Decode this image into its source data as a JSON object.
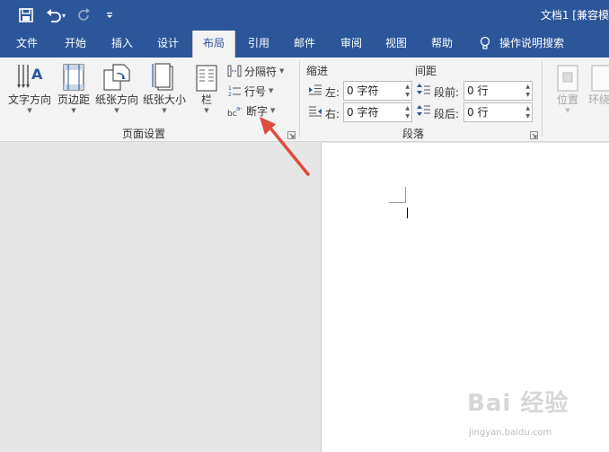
{
  "titlebar": {
    "doc_title": "文档1 [兼容模"
  },
  "tabs": [
    "文件",
    "开始",
    "插入",
    "设计",
    "布局",
    "引用",
    "邮件",
    "审阅",
    "视图",
    "帮助"
  ],
  "tell_me": "操作说明搜索",
  "ribbon": {
    "text_direction": "文字方向",
    "margins": "页边距",
    "orientation": "纸张方向",
    "size": "纸张大小",
    "columns": "栏",
    "breaks": "分隔符",
    "line_numbers": "行号",
    "hyphenation": "断字",
    "page_setup_group": "页面设置",
    "indent_title": "缩进",
    "spacing_title": "间距",
    "left_label": "左:",
    "right_label": "右:",
    "before_label": "段前:",
    "after_label": "段后:",
    "indent_left_value": "0 字符",
    "indent_right_value": "0 字符",
    "spacing_before_value": "0 行",
    "spacing_after_value": "0 行",
    "paragraph_group": "段落",
    "position": "位置",
    "wrap_text": "环绕"
  },
  "watermark": {
    "main": "Bai 经验",
    "sub": "jingyan.baidu.com"
  },
  "colors": {
    "accent": "#2b579a",
    "arrow": "#e04a3f"
  }
}
